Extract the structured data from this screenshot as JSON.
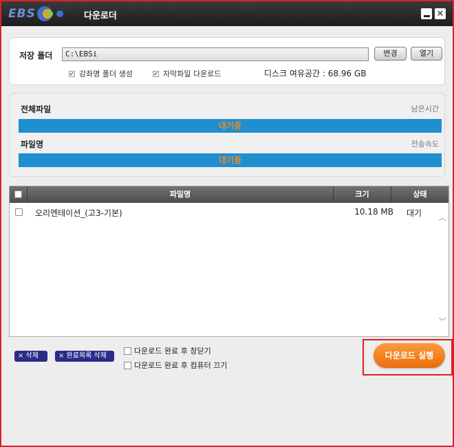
{
  "window": {
    "title": "다운로더",
    "logo_text": "EBS",
    "close_symbol": "✕"
  },
  "settings": {
    "folder_label": "저장 폴더",
    "folder_path": "C:\\EBSi",
    "change_label": "변경",
    "open_label": "열기",
    "option_lecture_folder": "강좌명 폴더 생성",
    "option_subtitle_download": "자막파일 다운로드",
    "disk_space": "디스크 여유공간 : 68.96 GB"
  },
  "progress": {
    "total_label": "전체파일",
    "remaining_label": "남은시간",
    "total_status": "대기중",
    "file_label": "파일명",
    "speed_label": "전송속도",
    "file_status": "대기중",
    "bar_color": "#1f8fd0",
    "status_text_color": "#f28a1c"
  },
  "table": {
    "columns": [
      "파일명",
      "크기",
      "상태"
    ],
    "rows": [
      {
        "name": "오리엔테이션_(고3-기본)",
        "size": "10.18 MB",
        "status": "대기"
      }
    ]
  },
  "actions": {
    "delete_label": "× 삭제",
    "delete_completed_label": "× 완료목록 삭제",
    "close_after_label": "다운로드 완료 후 창닫기",
    "shutdown_after_label": "다운로드 완료 후 컴퓨터 끄기",
    "run_label": "다운로드 실행",
    "run_color": "#ef7a16",
    "highlight_color": "#e01c1c"
  }
}
